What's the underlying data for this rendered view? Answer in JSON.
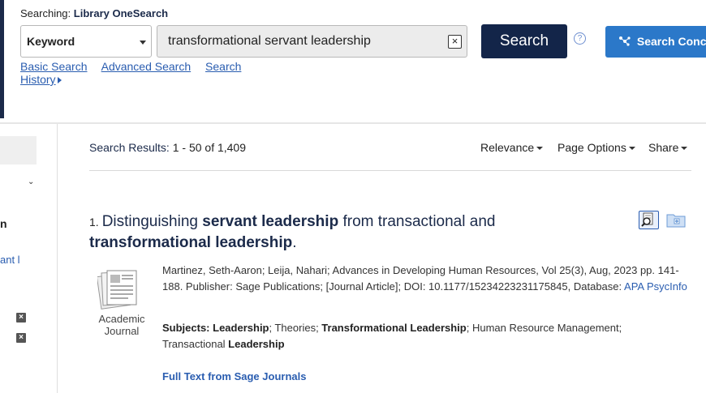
{
  "header": {
    "searching_prefix": "Searching:",
    "searching_db": "Library OneSearch",
    "field_select": "Keyword",
    "query": "transformational servant leadership",
    "clear_glyph": "×",
    "search_button": "Search",
    "help_glyph": "?",
    "concept_button": "Search Conc",
    "links": [
      "Basic Search",
      "Advanced Search",
      "Search History"
    ]
  },
  "sidebar": {
    "fragment_heading": "n",
    "fragment_link": "ant l",
    "remove_glyph": "×"
  },
  "results": {
    "count_label": "Search Results:",
    "count_value": "1 - 50 of 1,409",
    "options": [
      "Relevance",
      "Page Options",
      "Share"
    ]
  },
  "result_1": {
    "number": "1.",
    "title_parts": [
      {
        "text": "Distinguishing ",
        "bold": false
      },
      {
        "text": "servant leadership",
        "bold": true
      },
      {
        "text": " from transactional and ",
        "bold": false
      },
      {
        "text": "transformational leadership",
        "bold": true
      },
      {
        "text": ".",
        "bold": false
      }
    ],
    "type_label_1": "Academic",
    "type_label_2": "Journal",
    "meta_text": "Martinez, Seth-Aaron; Leija, Nahari; Advances in Developing Human Resources, Vol 25(3), Aug, 2023 pp. 141-188. Publisher: Sage Publications; [Journal Article]; DOI: 10.1177/15234223231175845, Database: ",
    "database": "APA PsycInfo",
    "subjects_label": "Subjects:",
    "subjects": [
      {
        "text": "Leadership",
        "bold": true
      },
      {
        "text": "; Theories; ",
        "bold": false
      },
      {
        "text": "Transformational Leadership",
        "bold": true
      },
      {
        "text": "; Human Resource Management; Transactional ",
        "bold": false
      },
      {
        "text": "Leadership",
        "bold": true
      }
    ],
    "full_text_link": "Full Text from Sage Journals"
  },
  "colors": {
    "navy": "#132549",
    "link_blue": "#2a5db0",
    "concept_blue": "#2b78c9"
  }
}
